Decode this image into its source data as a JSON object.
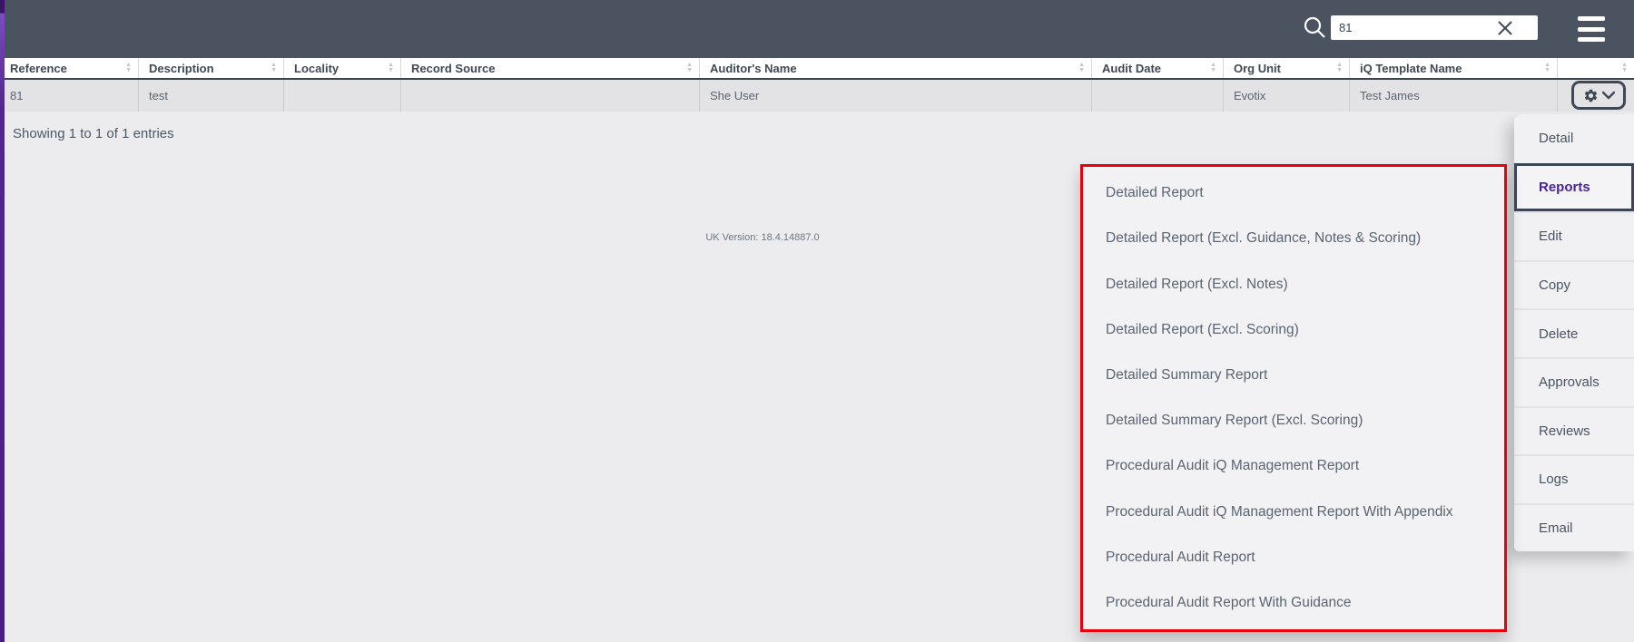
{
  "header": {
    "search": {
      "value": "81"
    }
  },
  "icons": {
    "sort_asc": "▲",
    "sort_desc": "▼"
  },
  "table": {
    "columns": [
      {
        "label": "Reference"
      },
      {
        "label": "Description"
      },
      {
        "label": "Locality"
      },
      {
        "label": "Record Source"
      },
      {
        "label": "Auditor's Name"
      },
      {
        "label": "Audit Date"
      },
      {
        "label": "Org Unit"
      },
      {
        "label": "iQ Template Name"
      },
      {
        "label": ""
      }
    ],
    "row": {
      "reference": "81",
      "description": "test",
      "locality": "",
      "record_source": "",
      "auditors_name": "She User",
      "audit_date": "",
      "org_unit": "Evotix",
      "iq_template_name": "Test James"
    },
    "summary": "Showing 1 to 1 of 1 entries"
  },
  "version_text": "UK Version: 18.4.14887.0",
  "row_menu": {
    "items": [
      "Detail",
      "Reports",
      "Edit",
      "Copy",
      "Delete",
      "Approvals",
      "Reviews",
      "Logs",
      "Email"
    ],
    "selected": "Reports"
  },
  "reports_submenu": {
    "items": [
      "Detailed Report",
      "Detailed Report (Excl. Guidance, Notes & Scoring)",
      "Detailed Report (Excl. Notes)",
      "Detailed Report (Excl. Scoring)",
      "Detailed Summary Report",
      "Detailed Summary Report (Excl. Scoring)",
      "Procedural Audit iQ Management Report",
      "Procedural Audit iQ Management Report With Appendix",
      "Procedural Audit Report",
      "Procedural Audit Report With Guidance"
    ]
  }
}
